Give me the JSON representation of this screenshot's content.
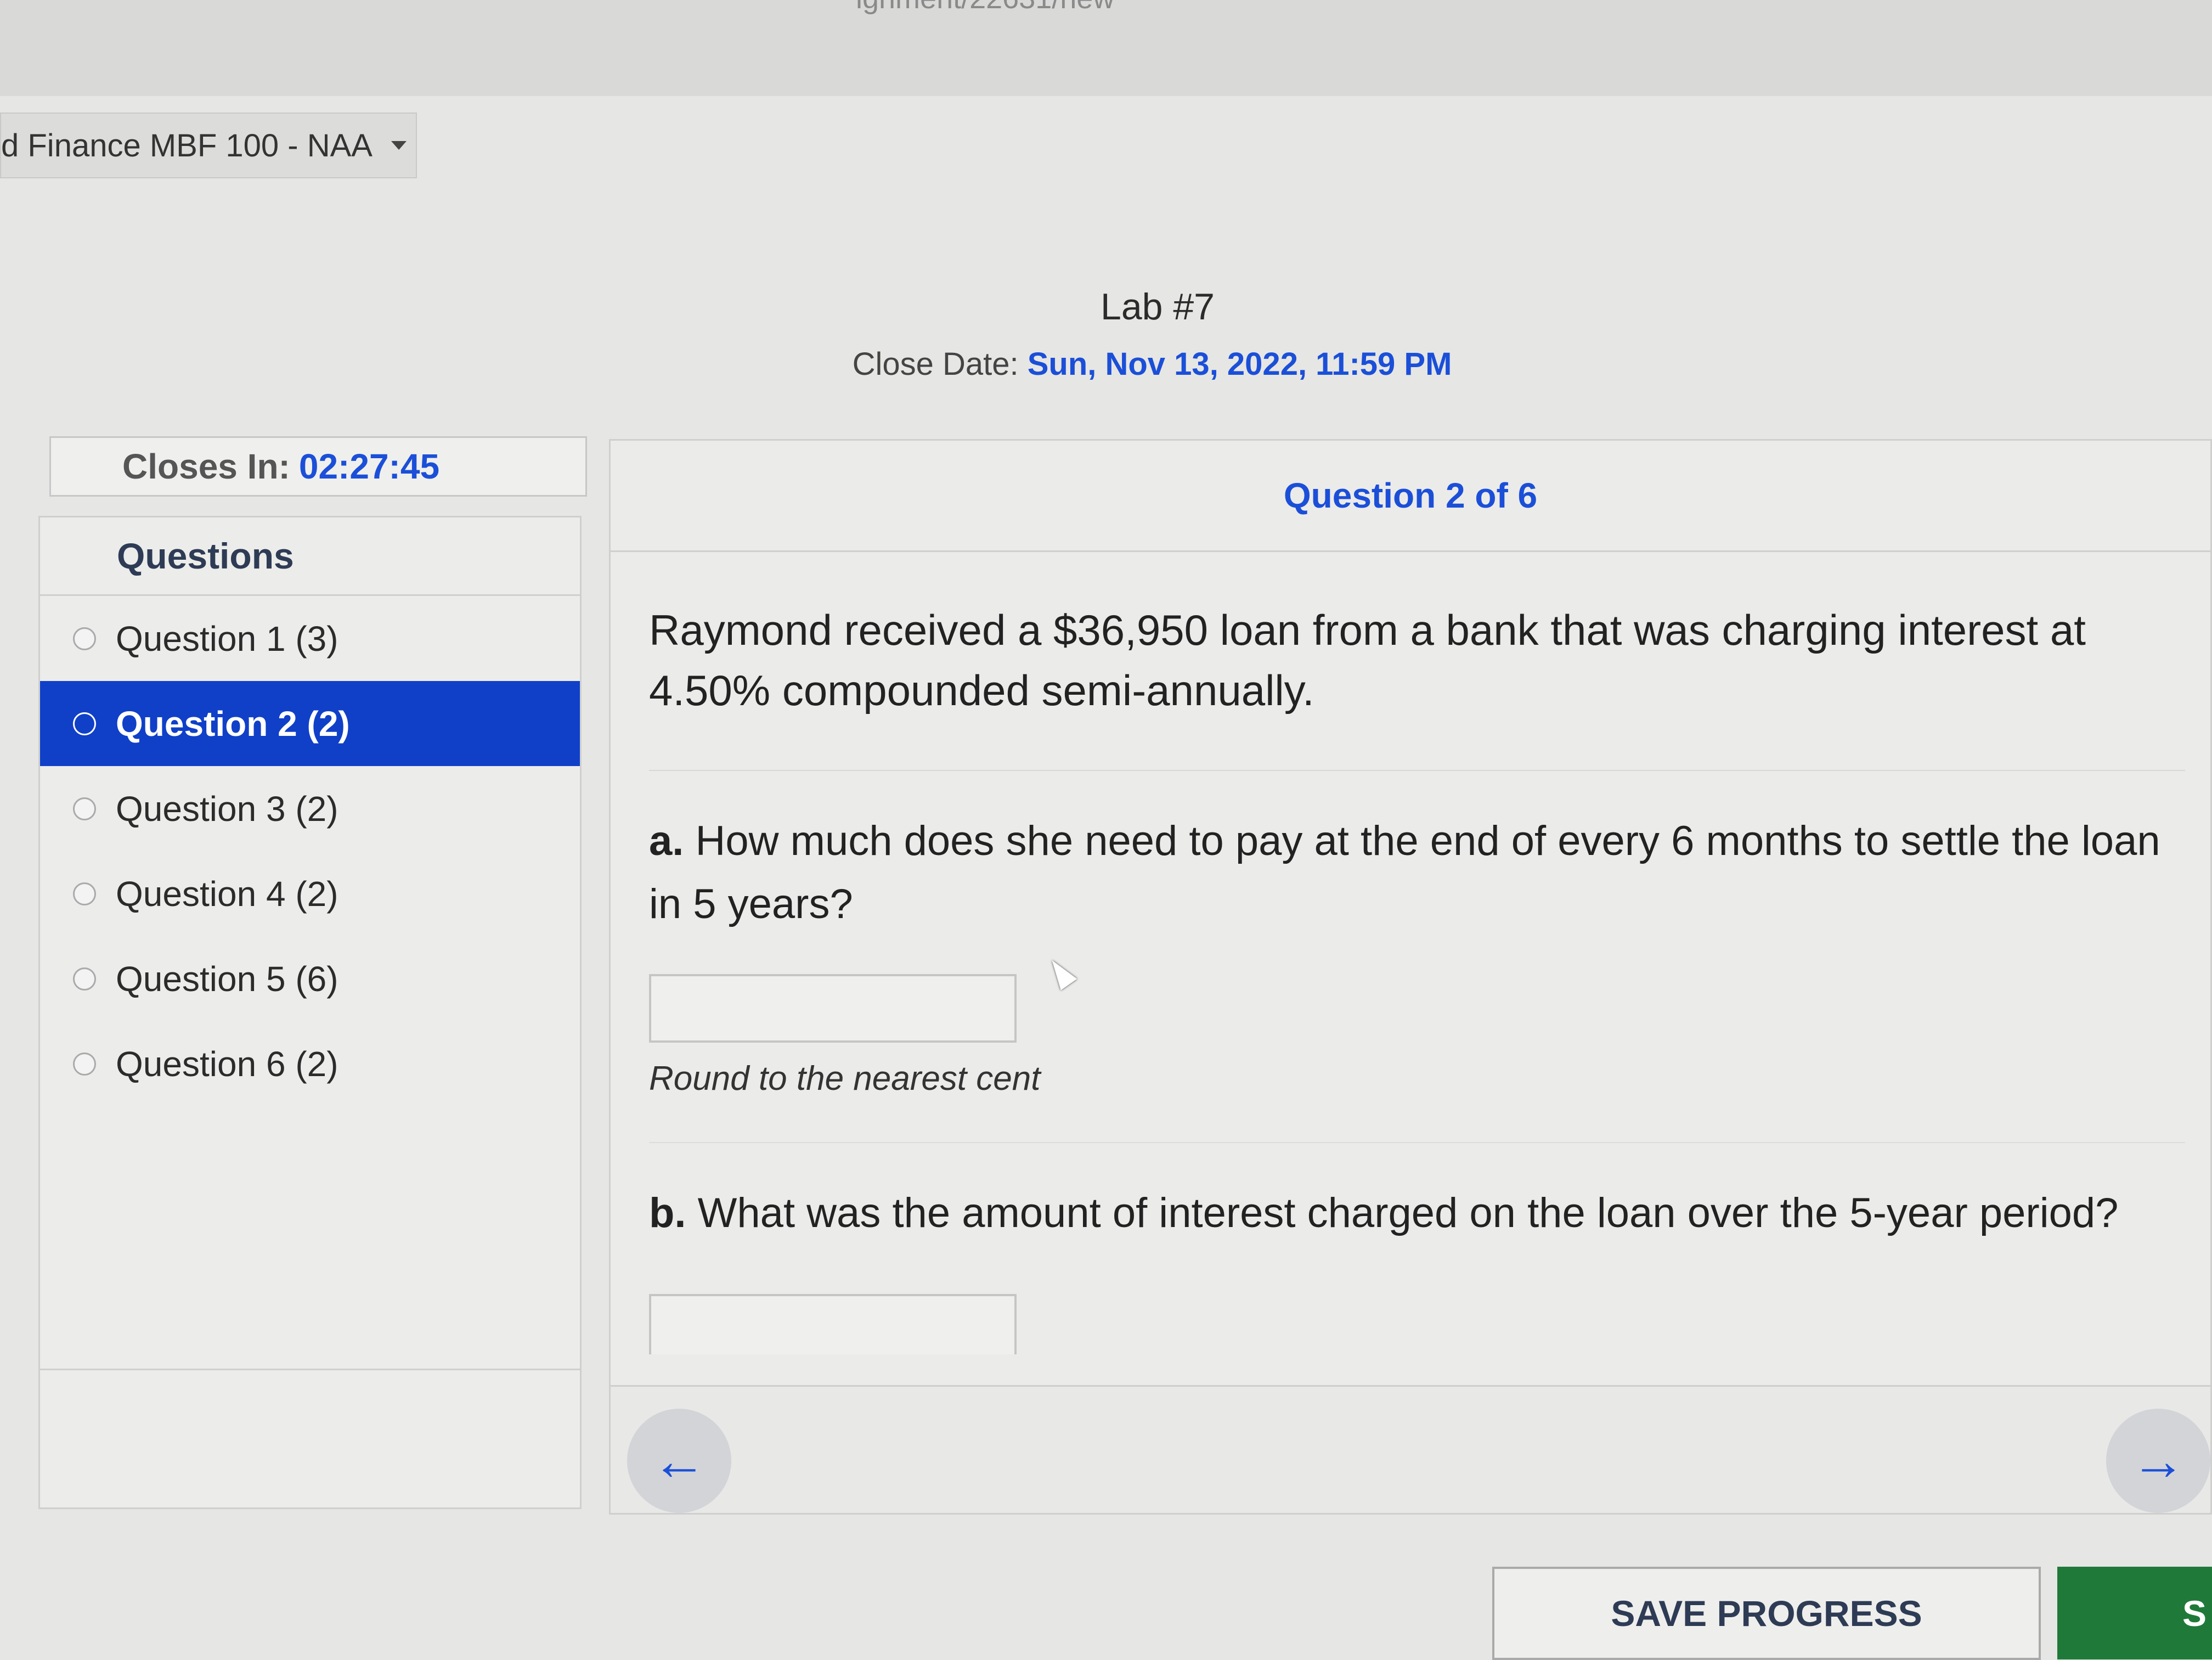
{
  "browser": {
    "url_fragment": "ignment/22631/new"
  },
  "header": {
    "course": "Finance MBF 100 - NAA"
  },
  "assignment": {
    "title": "Lab #7",
    "close_date_label": "Close Date:",
    "close_date_value": "Sun, Nov 13, 2022, 11:59 PM"
  },
  "timer": {
    "label": "Closes In:",
    "value": "02:27:45"
  },
  "sidebar": {
    "heading": "Questions",
    "items": [
      {
        "label": "Question 1  (3)"
      },
      {
        "label": "Question 2  (2)",
        "active": true
      },
      {
        "label": "Question 3  (2)"
      },
      {
        "label": "Question 4  (2)"
      },
      {
        "label": "Question 5  (6)"
      },
      {
        "label": "Question 6  (2)"
      }
    ]
  },
  "question": {
    "header": "Question 2 of 6",
    "intro": "Raymond received a $36,950 loan from a bank that was charging interest at 4.50% compounded semi-annually.",
    "part_a_label": "a.",
    "part_a_text": "How much does she need to pay at the end of every 6 months to settle the loan in 5 years?",
    "part_a_value": "",
    "hint": "Round to the nearest cent",
    "part_b_label": "b.",
    "part_b_text": "What was the amount of interest charged on the loan over the 5-year period?",
    "part_b_value": ""
  },
  "nav": {
    "prev_icon": "←",
    "next_icon": "→"
  },
  "footer": {
    "save_label": "SAVE PROGRESS",
    "submit_label": "S"
  },
  "colors": {
    "accent": "#1b4fd8",
    "active_item": "#1040c8",
    "submit": "#1f7a3a"
  }
}
